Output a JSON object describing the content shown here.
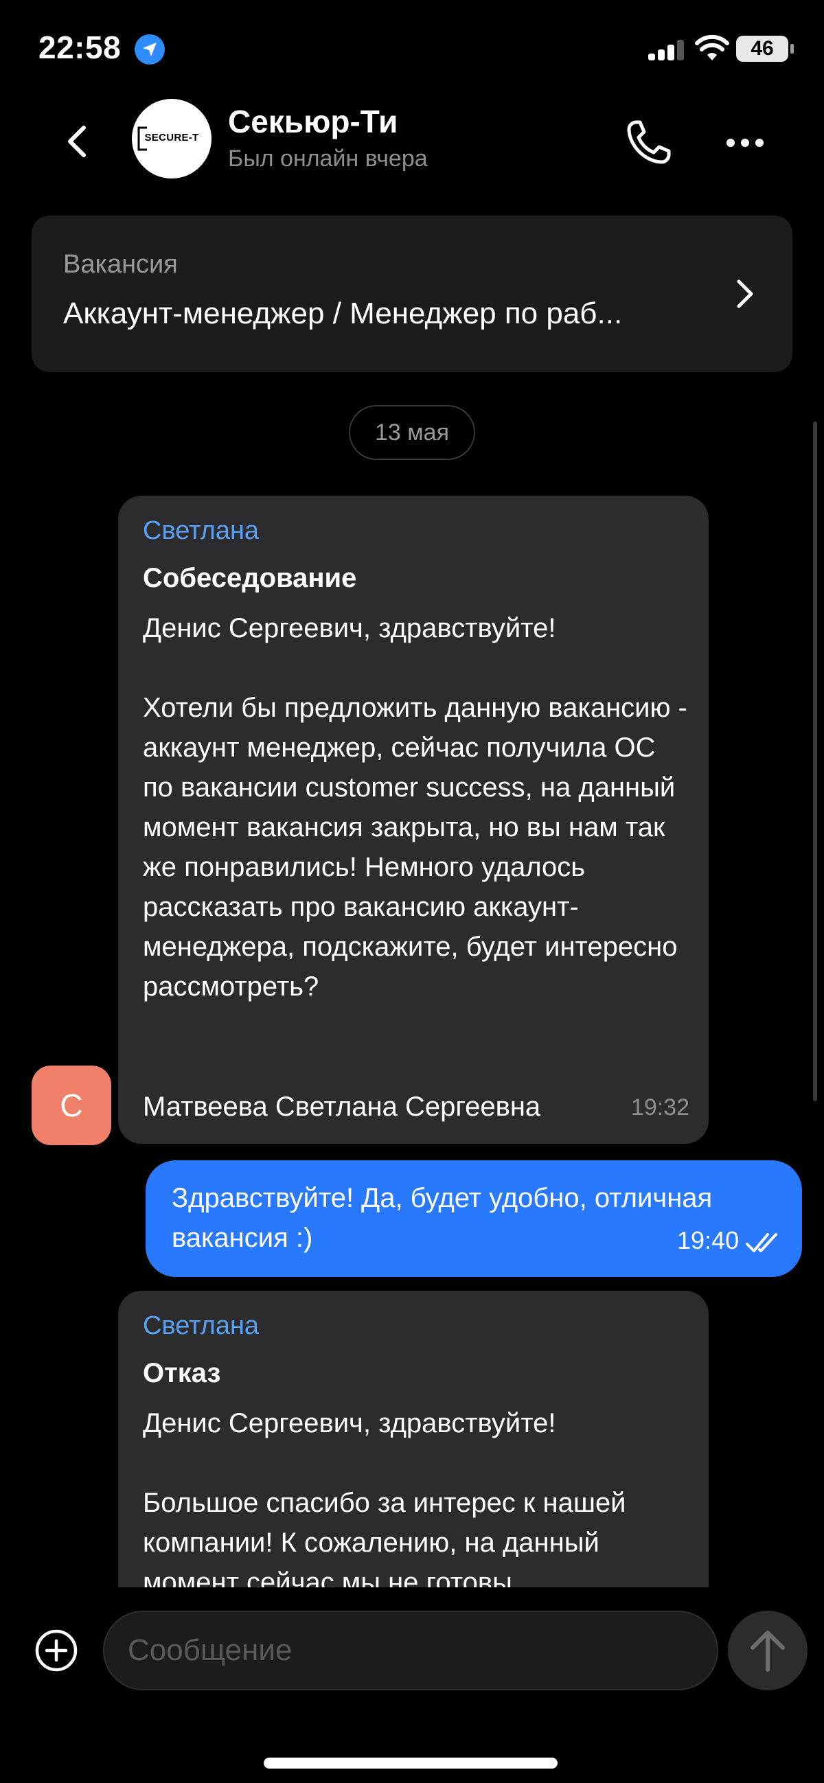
{
  "status_bar": {
    "time": "22:58",
    "battery": "46",
    "location_icon": "location-arrow-icon",
    "signal_icon": "cellular-signal-icon",
    "wifi_icon": "wifi-icon"
  },
  "header": {
    "contact_name": "Секьюр-Ти",
    "contact_status": "Был онлайн вчера",
    "logo_text": "SECURE-T",
    "back_icon": "chevron-left-icon",
    "call_icon": "phone-icon",
    "more_icon": "more-dots-icon"
  },
  "vacancy": {
    "label": "Вакансия",
    "title": "Аккаунт-менеджер / Менеджер по раб..."
  },
  "date_separator": "13 мая",
  "messages": [
    {
      "direction": "incoming",
      "sender": "Светлана",
      "subject": "Собеседование",
      "body": "Денис Сергеевич, здравствуйте!\n\nХотели бы предложить данную вакансию - аккаунт менеджер, сейчас получила ОС по вакансии customer success, на данный момент вакансия закрыта, но вы нам так же понравились! Немного удалось рассказать про вакансию аккаунт-менеджера, подскажите, будет интересно рассмотреть?",
      "signature": "Матвеева Светлана Сергеевна",
      "time": "19:32",
      "avatar_letter": "С"
    },
    {
      "direction": "outgoing",
      "text": "Здравствуйте! Да, будет удобно, отличная вакансия :)",
      "time": "19:40",
      "status_icon": "double-check-icon"
    },
    {
      "direction": "incoming",
      "sender": "Светлана",
      "subject": "Отказ",
      "body": "Денис Сергеевич, здравствуйте!\n\nБольшое спасибо за интерес к нашей компании! К сожалению, на данный момент сейчас мы не готовы"
    }
  ],
  "composer": {
    "placeholder": "Сообщение",
    "attach_icon": "plus-circle-icon",
    "send_icon": "arrow-up-icon"
  },
  "colors": {
    "background": "#000000",
    "incoming_bubble": "#2c2c2e",
    "outgoing_bubble": "#2979ff",
    "sender_name": "#5aa0f2",
    "avatar": "#f0806a"
  }
}
